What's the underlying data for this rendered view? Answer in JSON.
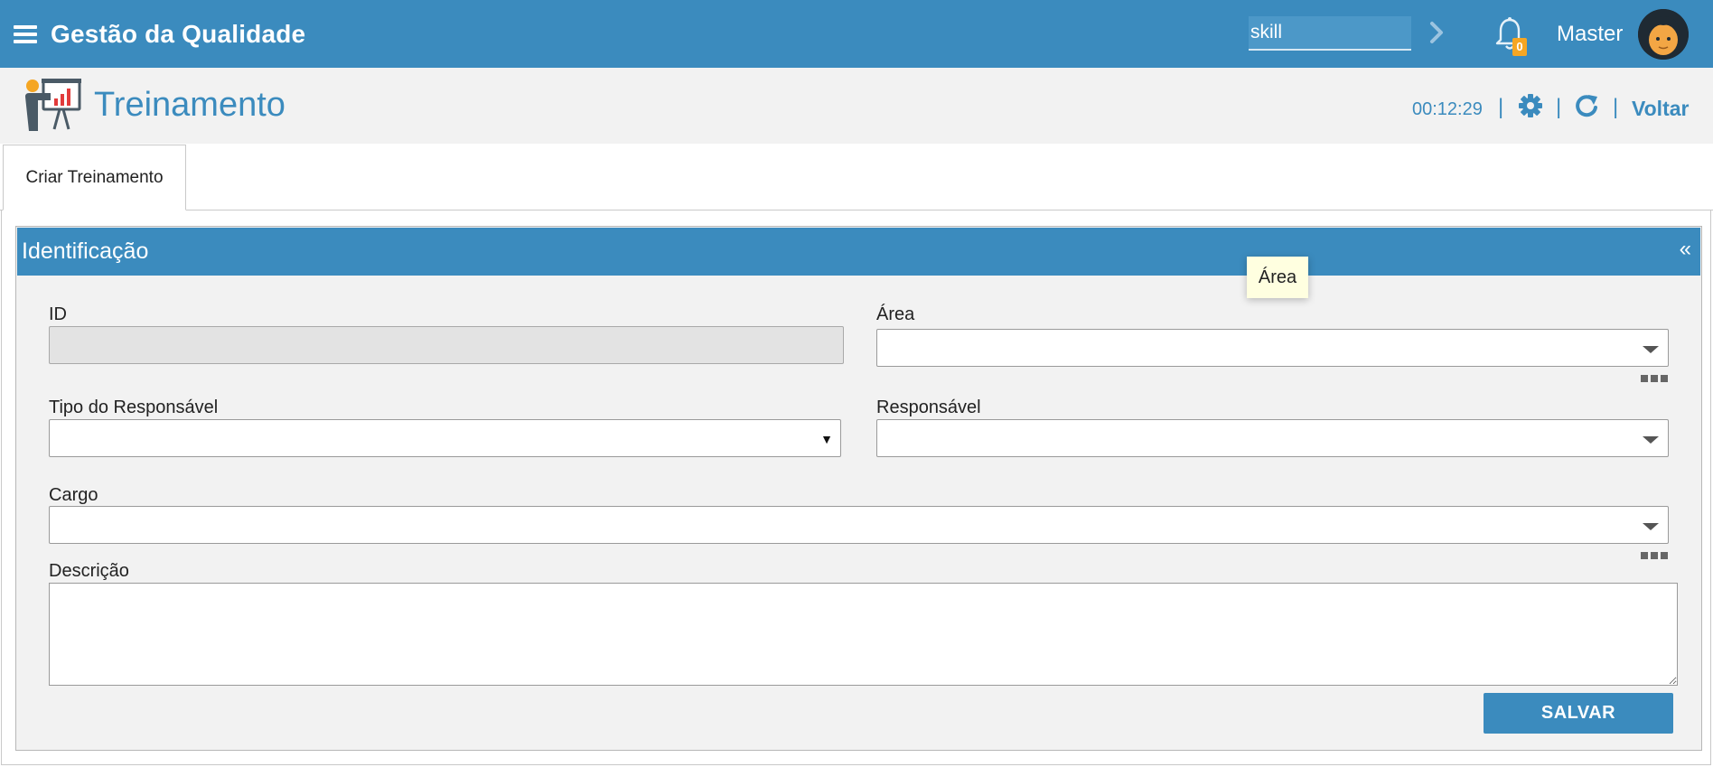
{
  "app": {
    "title": "Gestão da Qualidade",
    "search_value": "skill",
    "notification_count": "0",
    "user_name": "Master"
  },
  "page": {
    "title": "Treinamento",
    "timer": "00:12:29",
    "separator": "|",
    "back_label": "Voltar"
  },
  "tabs": [
    {
      "label": "Criar Treinamento",
      "active": true
    }
  ],
  "panel": {
    "title": "Identificação",
    "collapse_label": "«"
  },
  "form": {
    "id_label": "ID",
    "id_value": "",
    "area_label": "Área",
    "tipo_responsavel_label": "Tipo do Responsável",
    "responsavel_label": "Responsável",
    "cargo_label": "Cargo",
    "descricao_label": "Descrição",
    "save_label": "SALVAR"
  },
  "tooltip": {
    "text": "Área"
  },
  "colors": {
    "brand_blue": "#3b8bbe",
    "panel_bg": "#f2f2f2",
    "badge_orange": "#f5a623",
    "tooltip_bg": "#ffffe0"
  },
  "icons": [
    "menu-icon",
    "chevron-right-icon",
    "bell-icon",
    "avatar",
    "training-presentation-icon",
    "gear-icon",
    "refresh-icon",
    "dropdown-caret-icon",
    "more-options-icon"
  ]
}
